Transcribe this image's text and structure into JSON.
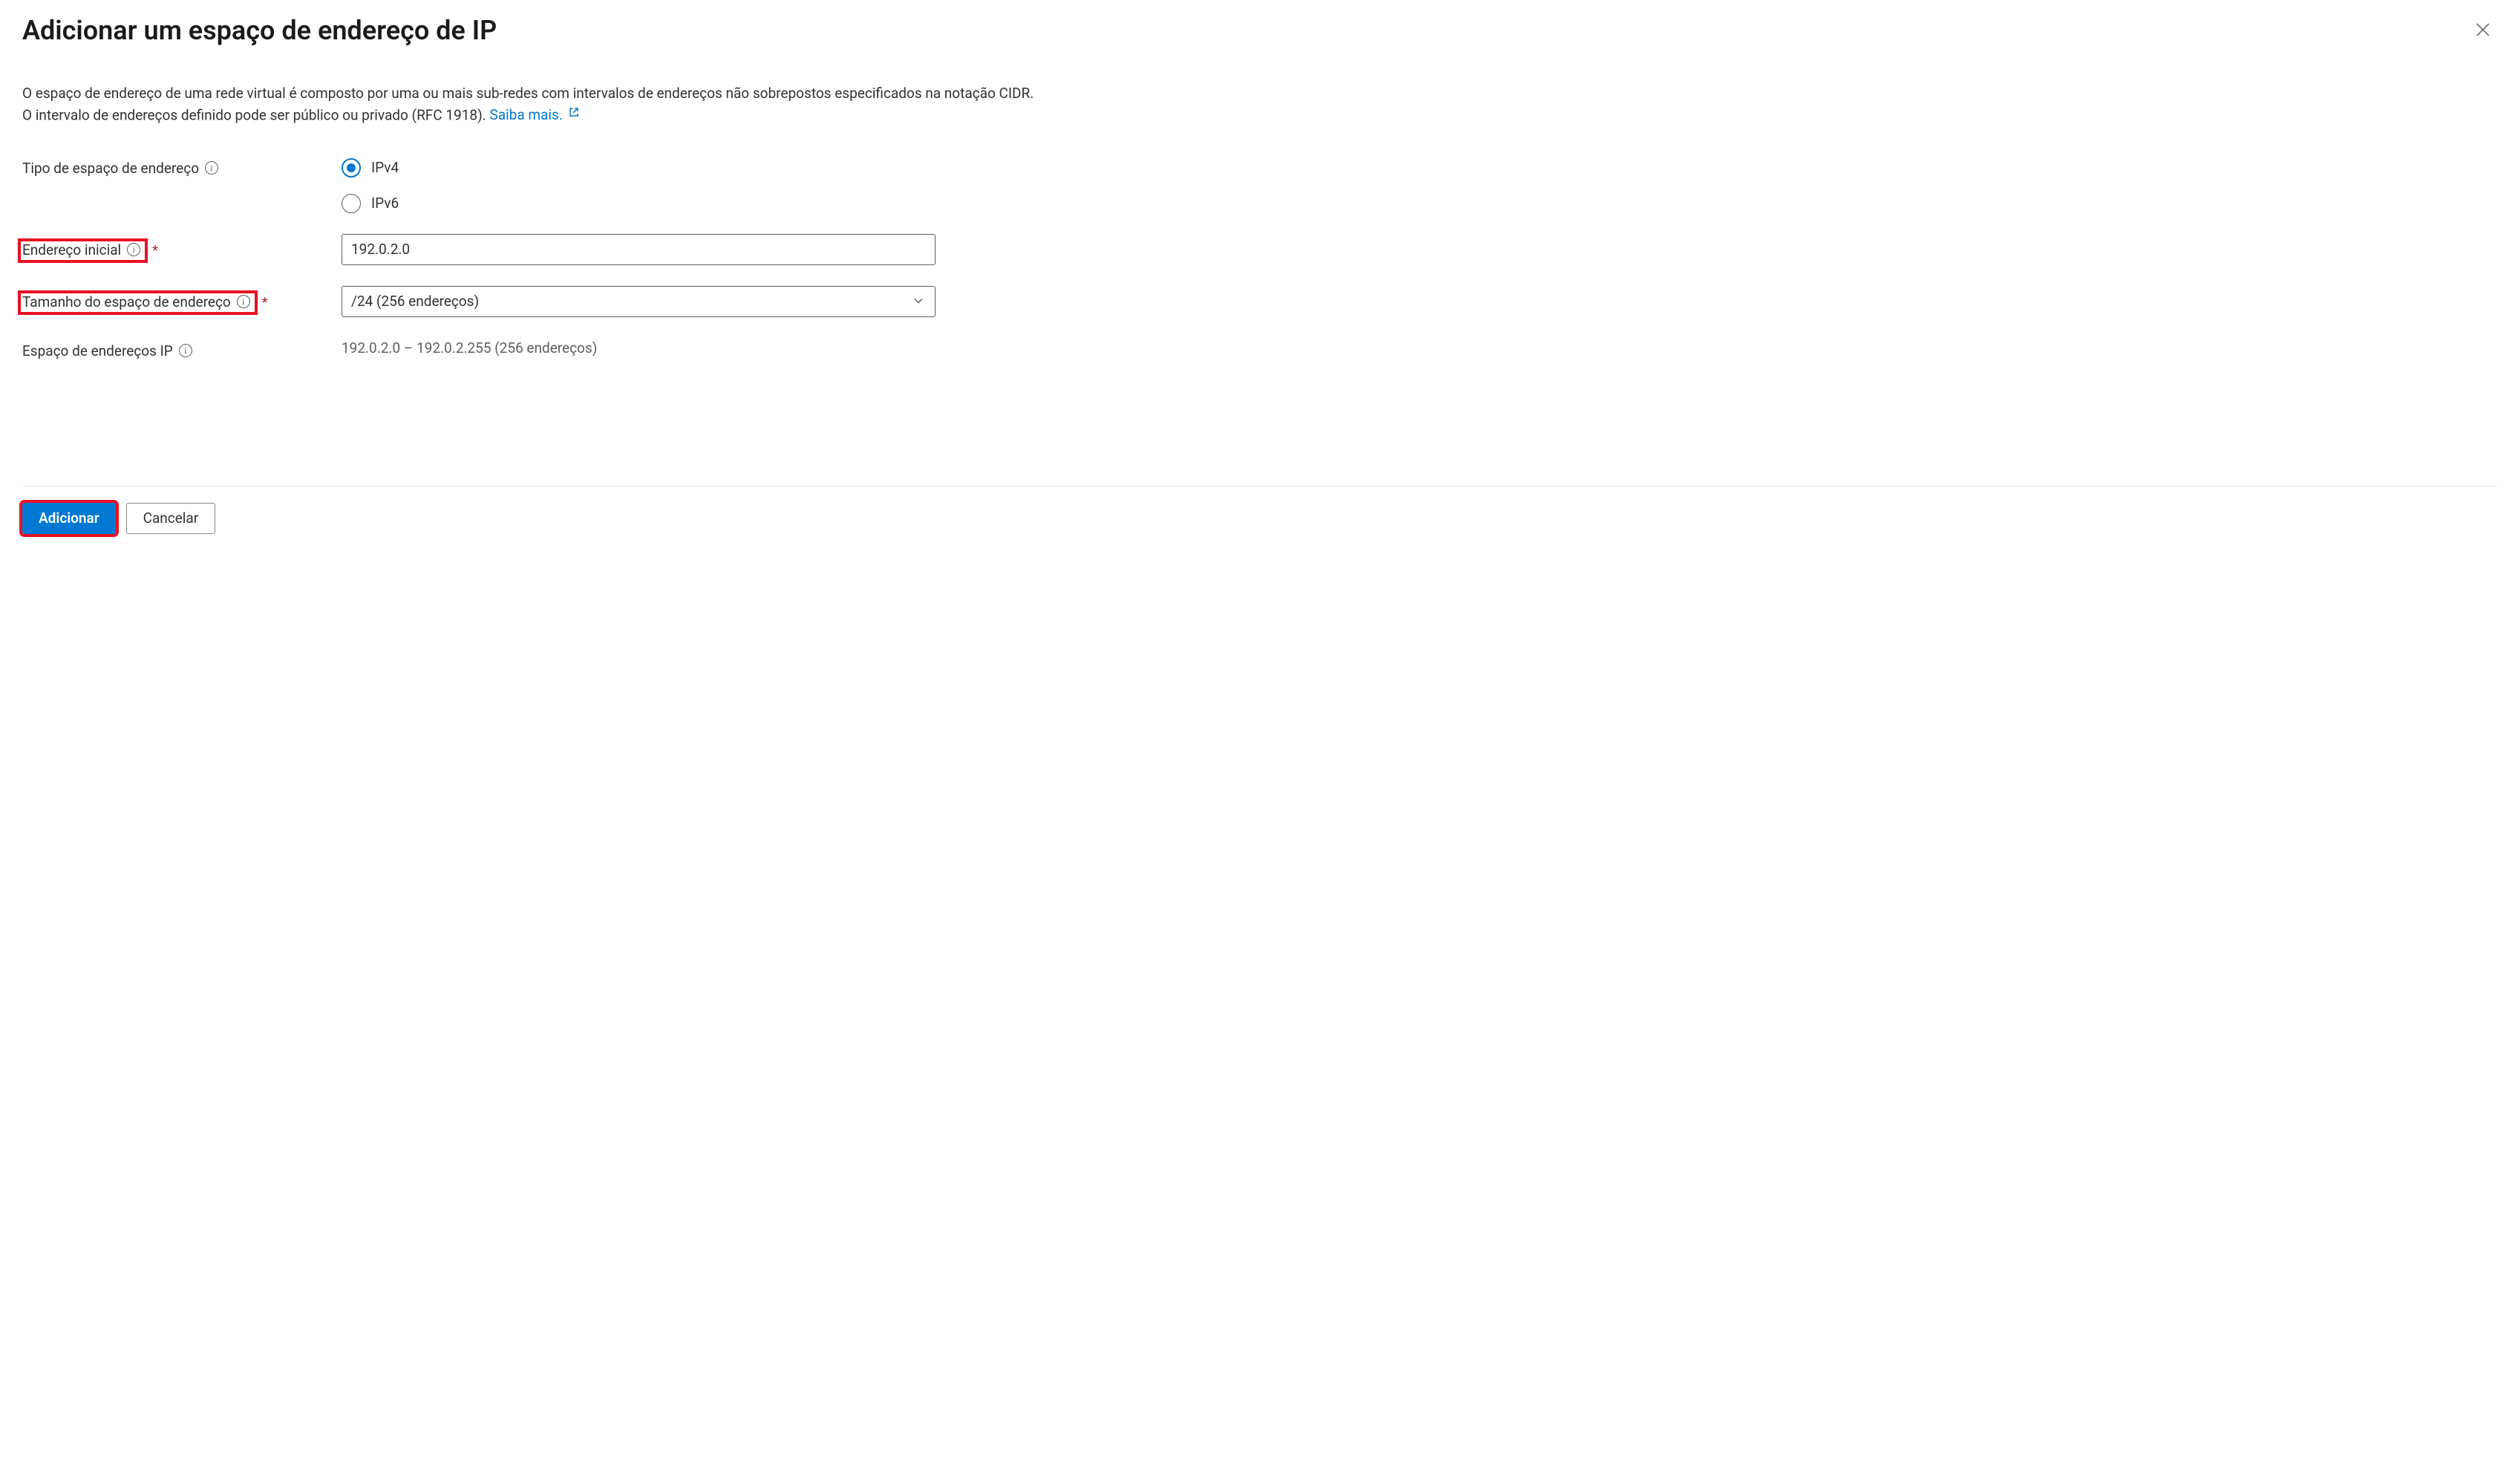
{
  "header": {
    "title": "Adicionar um espaço de endereço de IP"
  },
  "description": {
    "text": "O espaço de endereço de uma rede virtual é composto por uma ou mais sub-redes com intervalos de endereços não sobrepostos especificados na notação CIDR. O intervalo de endereços definido pode ser público ou privado (RFC 1918).",
    "learn_more": "Saiba mais."
  },
  "fields": {
    "address_type": {
      "label": "Tipo de espaço de endereço",
      "options": {
        "ipv4": "IPv4",
        "ipv6": "IPv6"
      },
      "selected": "ipv4"
    },
    "start_address": {
      "label": "Endereço inicial",
      "value": "192.0.2.0"
    },
    "address_size": {
      "label": "Tamanho do espaço de endereço",
      "value": "/24 (256 endereços)"
    },
    "ip_space": {
      "label": "Espaço de endereços IP",
      "value": "192.0.2.0 – 192.0.2.255 (256 endereços)"
    }
  },
  "footer": {
    "add": "Adicionar",
    "cancel": "Cancelar"
  }
}
